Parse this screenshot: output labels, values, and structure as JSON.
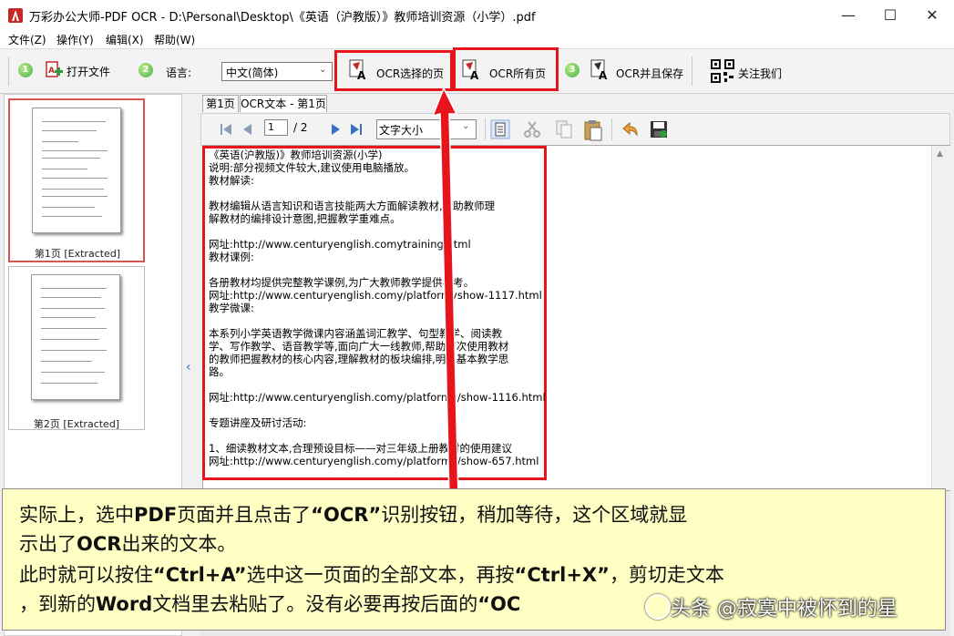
{
  "window": {
    "title": "万彩办公大师-PDF OCR - D:\\Personal\\Desktop\\《英语（沪教版）》教师培训资源（小学）.pdf",
    "controls": {
      "minimize": "—",
      "maximize": "☐",
      "close": "✕"
    }
  },
  "menu": [
    {
      "label": "文件(Z)"
    },
    {
      "label": "操作(Y)"
    },
    {
      "label": "编辑(X)"
    },
    {
      "label": "帮助(W)"
    }
  ],
  "toolbar": {
    "step1": "1",
    "open_file": "打开文件",
    "step2": "2",
    "language_label": "语言:",
    "language_value": "中文(简体)",
    "ocr_selected": "OCR选择的页",
    "ocr_all": "OCR所有页",
    "step3": "3",
    "ocr_save": "OCR并且保存",
    "follow_us": "关注我们"
  },
  "sidebar": {
    "thumbnails": [
      {
        "label": "第1页 [Extracted]",
        "selected": true
      },
      {
        "label": "第2页 [Extracted]",
        "selected": false
      }
    ]
  },
  "tabs": [
    {
      "label": "第1页",
      "active": false
    },
    {
      "label": "OCR文本 - 第1页",
      "active": true
    }
  ],
  "doc_toolbar": {
    "page_current": "1",
    "page_total": "/ 2",
    "font_size_label": "文字大小"
  },
  "ocr_text": [
    "《英语(沪教版)》教师培训资源(小学)",
    "说明:部分视频文件较大,建议使用电脑播放。",
    "教材解读:",
    "",
    "教材编辑从语言知识和语言技能两大方面解读教材,帮助教师理",
    "解教材的编排设计意图,把握教学重难点。",
    "",
    "网址:http://www.centuryenglish.comytraining.html",
    "教材课例:",
    "",
    "各册教材均提供完整教学课例,为广大教师教学提供参考。",
    "网址:http://www.centuryenglish.comy/platformyshow-1117.html",
    "教学微课:",
    "",
    "本系列小学英语教学微课内容涵盖词汇教学、句型教学、阅读教",
    "学、写作教学、语音教学等,面向广大一线教师,帮助初次使用教材",
    "的教师把握教材的核心内容,理解教材的板块编排,明确基本教学思",
    "路。",
    "",
    "网址:http://www.centuryenglish.comy/platformy/show-1116.html",
    "",
    "专题讲座及研讨活动:",
    "",
    "1、细读教材文本,合理预设目标——对三年级上册教材的使用建议",
    "网址:http://www.centuryenglish.comy/platformy/show-657.html"
  ],
  "callout": {
    "line1_a": "实际上，选中",
    "line1_b": "PDF",
    "line1_c": "页面并且点击了",
    "line1_d": "“OCR”",
    "line1_e": "识别按钮，稍加等待，这个区域就显",
    "line2_a": "示出了",
    "line2_b": "OCR",
    "line2_c": "出来的文本。",
    "line3_a": "此时就可以按住",
    "line3_b": "“Ctrl+A”",
    "line3_c": "选中这一页面的全部文本，再按",
    "line3_d": "“Ctrl+X”",
    "line3_e": "，剪切走文本",
    "line4_a": "，到新的",
    "line4_b": "Word",
    "line4_c": "文档里去粘贴了。没有必要再按后面的",
    "line4_d": "“OC"
  },
  "watermark": "头条 @寂寞中被怀到的星",
  "colors": {
    "highlight": "#e8141c",
    "callout_bg": "#ffffc3",
    "step_green": "#4caf50"
  }
}
